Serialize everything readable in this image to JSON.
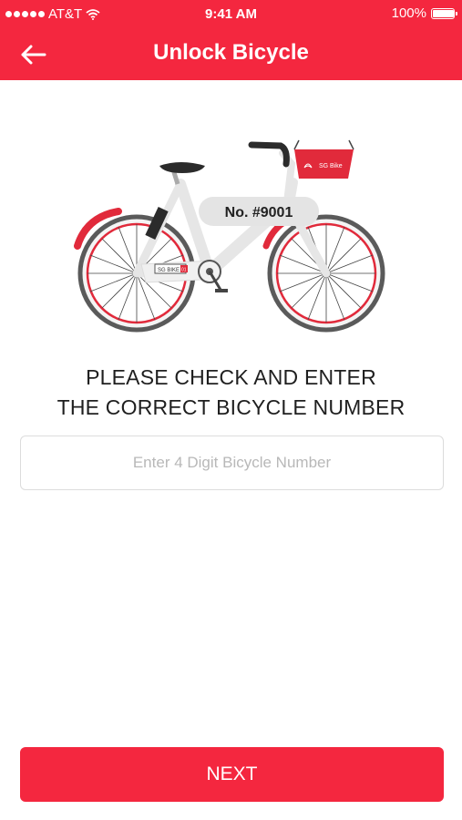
{
  "status_bar": {
    "carrier": "AT&T",
    "time": "9:41 AM",
    "battery": "100%",
    "battery_level": 1.0
  },
  "header": {
    "title": "Unlock Bicycle",
    "back_icon": "arrow-left-icon"
  },
  "illustration": {
    "plate_text": "No. #9001",
    "basket_text": "SG Bike",
    "frame_tag_text": "SG BIKE",
    "frame_tag_code": "01"
  },
  "prompt": {
    "line1": "PLEASE CHECK AND ENTER",
    "line2": "THE CORRECT BICYCLE NUMBER"
  },
  "bike_number_input": {
    "value": "",
    "placeholder": "Enter 4 Digit Bicycle Number"
  },
  "next_button": {
    "label": "NEXT"
  },
  "colors": {
    "brand_red": "#f4273f",
    "text_dark": "#1f1f1f",
    "placeholder": "#b8b8b8",
    "frame": "#e8e8e8"
  }
}
